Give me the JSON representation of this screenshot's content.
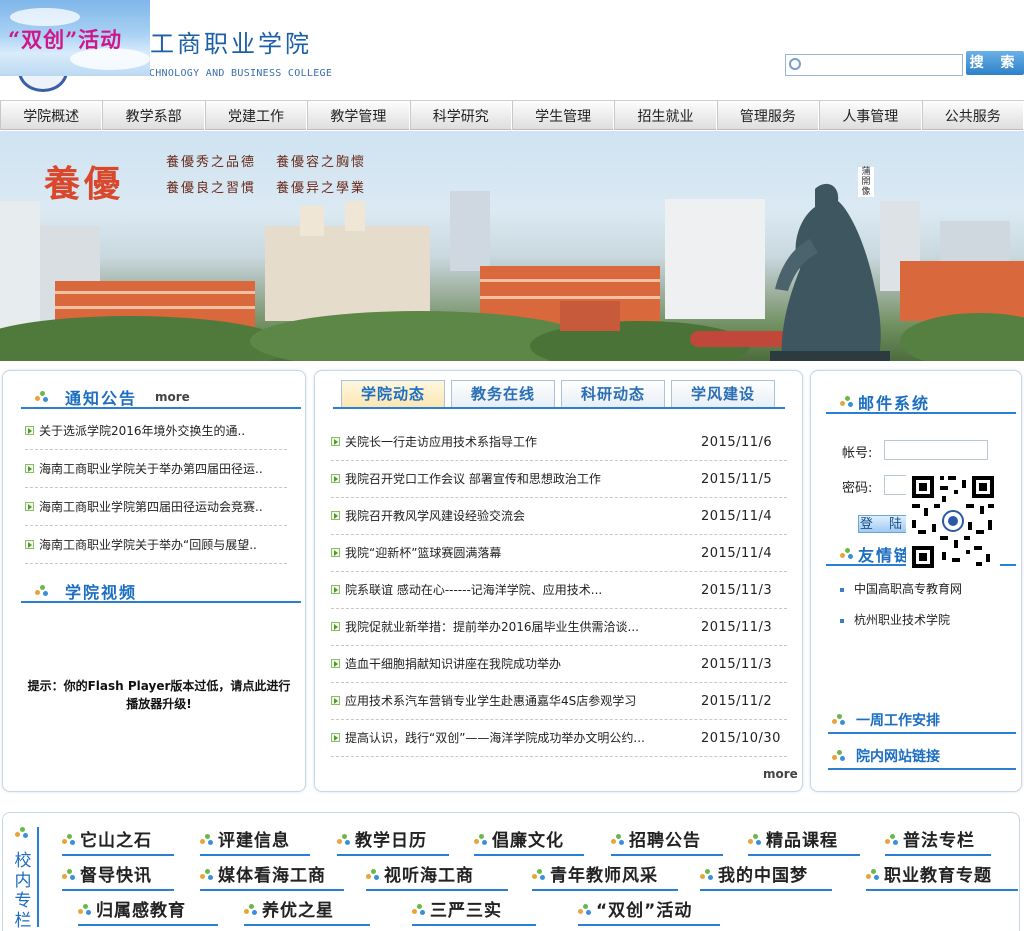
{
  "header": {
    "promo": "“双创”活动",
    "title": "工商职业学院",
    "subtitle": "HAINAN TECHNOLOGY AND BUSINESS COLLEGE",
    "search_placeholder": "",
    "search_button": "搜 索"
  },
  "nav": [
    "学院概述",
    "教学系部",
    "党建工作",
    "教学管理",
    "科学研究",
    "学生管理",
    "招生就业",
    "管理服务",
    "人事管理",
    "公共服务"
  ],
  "banner": {
    "slogan_main": "養優",
    "slogan_lines": [
      "養優秀之品德",
      "養優容之胸懷",
      "養優良之習慣",
      "養優异之學業"
    ],
    "statue_label": "蒲開像"
  },
  "notice": {
    "title": "通知公告",
    "more": "more",
    "items": [
      "关于选派学院2016年境外交换生的通..",
      "海南工商职业学院关于举办第四届田径运..",
      "海南工商职业学院第四届田径运动会竞赛..",
      "海南工商职业学院关于举办“回顾与展望.."
    ]
  },
  "video": {
    "title": "学院视频",
    "flash_notice": "提示：你的Flash Player版本过低，请点此进行播放器升级!"
  },
  "news": {
    "tabs": [
      "学院动态",
      "教务在线",
      "科研动态",
      "学风建设"
    ],
    "active_tab": "学院动态",
    "items": [
      {
        "title": "关院长一行走访应用技术系指导工作",
        "date": "2015/11/6"
      },
      {
        "title": "我院召开党口工作会议 部署宣传和思想政治工作",
        "date": "2015/11/5"
      },
      {
        "title": "我院召开教风学风建设经验交流会",
        "date": "2015/11/4"
      },
      {
        "title": "我院“迎新杯”篮球赛圆满落幕",
        "date": "2015/11/4"
      },
      {
        "title": "院系联谊 感动在心------记海洋学院、应用技术...",
        "date": "2015/11/3"
      },
      {
        "title": "我院促就业新举措：提前举办2016届毕业生供需洽谈...",
        "date": "2015/11/3"
      },
      {
        "title": "造血干细胞捐献知识讲座在我院成功举办",
        "date": "2015/11/3"
      },
      {
        "title": "应用技术系汽车营销专业学生赴惠通嘉华4S店参观学习",
        "date": "2015/11/2"
      },
      {
        "title": "提高认识，践行“双创”——海洋学院成功举办文明公约...",
        "date": "2015/10/30"
      }
    ],
    "more": "more"
  },
  "mail": {
    "title": "邮件系统",
    "account_label": "帐号:",
    "password_label": "密码:",
    "login_button": "登 陆"
  },
  "friends": {
    "title": "友情链接",
    "items": [
      "中国高职高专教育网",
      "杭州职业技术学院"
    ]
  },
  "side_links": [
    "一周工作安排",
    "院内网站链接"
  ],
  "column": {
    "label": "校内专栏",
    "links": [
      "它山之石",
      "评建信息",
      "教学日历",
      "倡廉文化",
      "招聘公告",
      "精品课程",
      "普法专栏",
      "督导快讯",
      "媒体看海工商",
      "视听海工商",
      "青年教师风采",
      "我的中国梦",
      "职业教育专题",
      "归属感教育",
      "养优之星",
      "三严三实",
      "“双创”活动"
    ]
  },
  "colors": {
    "accent": "#1c6ec3",
    "rule": "#2a7fd2",
    "promo": "#d0178a",
    "slogan": "#d9482b"
  }
}
